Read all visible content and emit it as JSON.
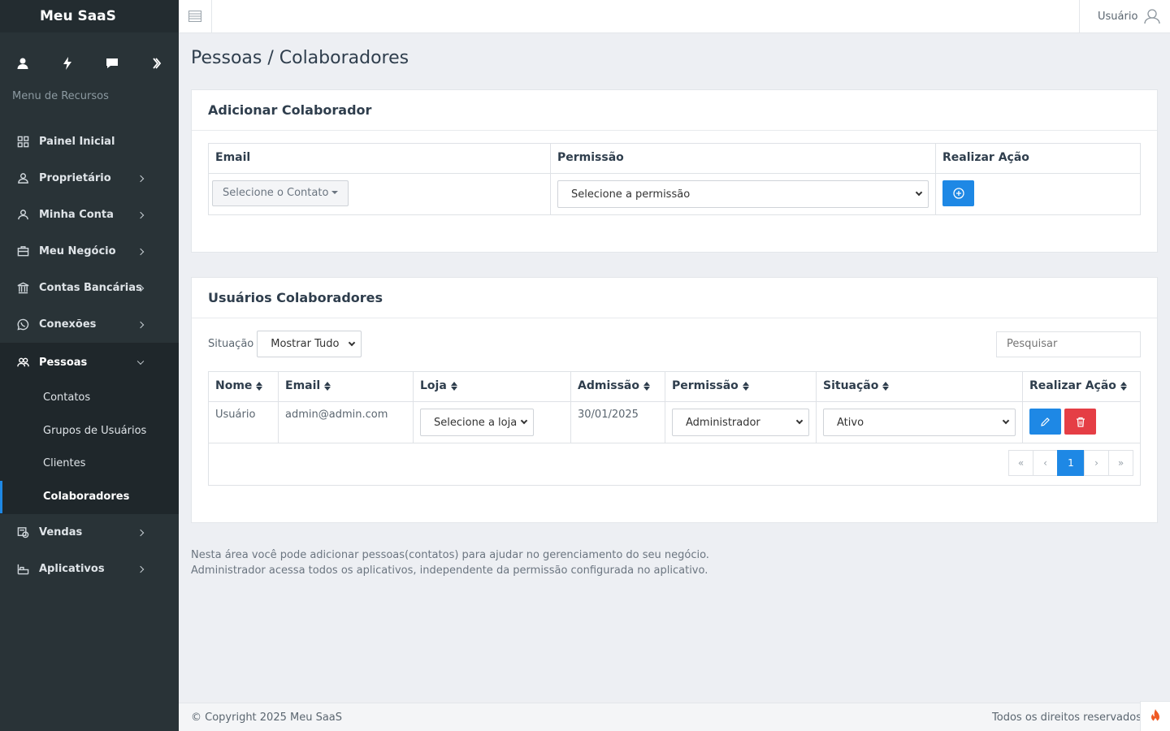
{
  "app": {
    "brand": "Meu SaaS"
  },
  "sidebar": {
    "quick_icons": [
      "user-icon",
      "bolt-icon",
      "chat-icon",
      "chevron-right-icon"
    ],
    "menu_header": "Menu de Recursos",
    "items": [
      {
        "label": "Painel Inicial",
        "icon": "grid-icon"
      },
      {
        "label": "Proprietário",
        "icon": "user-badge-icon"
      },
      {
        "label": "Minha Conta",
        "icon": "user-icon"
      },
      {
        "label": "Meu Negócio",
        "icon": "briefcase-icon"
      },
      {
        "label": "Contas Bancárias",
        "icon": "bank-icon"
      },
      {
        "label": "Conexões",
        "icon": "whatsapp-icon"
      },
      {
        "label": "Pessoas",
        "icon": "people-icon"
      },
      {
        "label": "Vendas",
        "icon": "sales-icon"
      },
      {
        "label": "Aplicativos",
        "icon": "apps-icon"
      }
    ],
    "pessoas_submenu": [
      "Contatos",
      "Grupos de Usuários",
      "Clientes",
      "Colaboradores"
    ],
    "active_subitem": "Colaboradores"
  },
  "topbar": {
    "user_label": "Usuário"
  },
  "page": {
    "title": "Pessoas / Colaboradores"
  },
  "add_card": {
    "title": "Adicionar Colaborador",
    "headers": [
      "Email",
      "Permissão",
      "Realizar Ação"
    ],
    "contact_dropdown": "Selecione o Contato",
    "permission_select": "Selecione a permissão"
  },
  "users_card": {
    "title": "Usuários Colaboradores",
    "filter_label": "Situação",
    "filter_value": "Mostrar Tudo",
    "search_placeholder": "Pesquisar",
    "headers": [
      "Nome",
      "Email",
      "Loja",
      "Admissão",
      "Permissão",
      "Situação",
      "Realizar Ação"
    ],
    "rows": [
      {
        "nome": "Usuário",
        "email": "admin@admin.com",
        "loja": "Selecione a loja",
        "admissao": "30/01/2025",
        "permissao": "Administrador",
        "situacao": "Ativo"
      }
    ],
    "pagination": {
      "first": "«",
      "prev": "‹",
      "current": "1",
      "next": "›",
      "last": "»"
    }
  },
  "info": {
    "line1": "Nesta área você pode adicionar pessoas(contatos) para ajudar no gerenciamento do seu negócio.",
    "line2": "Administrador acessa todos os aplicativos, independente da permissão configurada no aplicativo."
  },
  "footer": {
    "copyright": "© Copyright 2025 Meu SaaS",
    "rights": "Todos os direitos reservados"
  },
  "colors": {
    "sidebar": "#293337",
    "accent": "#1e88e5",
    "danger": "#e53e45",
    "background": "#edeff3"
  }
}
